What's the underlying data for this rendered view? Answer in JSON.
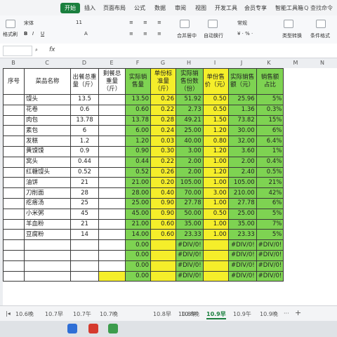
{
  "ribbon": {
    "tabs": [
      "开始",
      "插入",
      "页面布局",
      "公式",
      "数据",
      "审阅",
      "视图",
      "开发工具",
      "会员专享",
      "智能工具箱"
    ],
    "active_index": 0,
    "search": "Q 查找命令"
  },
  "toolbar": {
    "paste_format": "格式刷",
    "font_name": "宋体",
    "font_size": "11",
    "merge_center": "合并居中",
    "wrap": "自动换行",
    "number_format": "常规",
    "type_convert": "类型转换",
    "conditional_format": "条件格式"
  },
  "formula_bar": {
    "fx": "fx",
    "value": ""
  },
  "columns": [
    "B",
    "C",
    "D",
    "E",
    "F",
    "G",
    "H",
    "I",
    "J",
    "K",
    "M",
    "N"
  ],
  "headers": {
    "seq": "序号",
    "dish": "菜品名称",
    "d": "出餐总重量（斤）",
    "e": "剩餐总重量（斤）",
    "f": "实际销售量",
    "g": "单份标准量（斤）",
    "h": "实际销售份数（份）",
    "i": "单份售价（元）",
    "j": "实际销售额（元）",
    "k": "销售额占比"
  },
  "rows": [
    {
      "dish": "馒头",
      "d": "13.5",
      "f": "13.50",
      "g": "0.26",
      "h": "51.92",
      "i": "0.50",
      "j": "25.96",
      "k": "5%"
    },
    {
      "dish": "花卷",
      "d": "0.6",
      "f": "0.60",
      "g": "0.22",
      "h": "2.73",
      "i": "0.50",
      "j": "1.36",
      "k": "0.3%"
    },
    {
      "dish": "肉包",
      "d": "13.78",
      "f": "13.78",
      "g": "0.28",
      "h": "49.21",
      "i": "1.50",
      "j": "73.82",
      "k": "15%"
    },
    {
      "dish": "素包",
      "d": "6",
      "f": "6.00",
      "g": "0.24",
      "h": "25.00",
      "i": "1.20",
      "j": "30.00",
      "k": "6%"
    },
    {
      "dish": "发糕",
      "d": "1.2",
      "f": "1.20",
      "g": "0.03",
      "h": "40.00",
      "i": "0.80",
      "j": "32.00",
      "k": "6.4%"
    },
    {
      "dish": "黄馍馍",
      "d": "0.9",
      "f": "0.90",
      "g": "0.30",
      "h": "3.00",
      "i": "1.20",
      "j": "3.60",
      "k": "1%"
    },
    {
      "dish": "窝头",
      "d": "0.44",
      "f": "0.44",
      "g": "0.22",
      "h": "2.00",
      "i": "1.00",
      "j": "2.00",
      "k": "0.4%"
    },
    {
      "dish": "红糖馒头",
      "d": "0.52",
      "f": "0.52",
      "g": "0.26",
      "h": "2.00",
      "i": "1.20",
      "j": "2.40",
      "k": "0.5%"
    },
    {
      "dish": "油饼",
      "d": "21",
      "f": "21.00",
      "g": "0.20",
      "h": "105.00",
      "i": "1.00",
      "j": "105.00",
      "k": "21%"
    },
    {
      "dish": "刀削面",
      "d": "28",
      "f": "28.00",
      "g": "0.40",
      "h": "70.00",
      "i": "3.00",
      "j": "210.00",
      "k": "42%"
    },
    {
      "dish": "疙瘩汤",
      "d": "25",
      "f": "25.00",
      "g": "0.90",
      "h": "27.78",
      "i": "1.00",
      "j": "27.78",
      "k": "6%"
    },
    {
      "dish": "小米粥",
      "d": "45",
      "f": "45.00",
      "g": "0.90",
      "h": "50.00",
      "i": "0.50",
      "j": "25.00",
      "k": "5%"
    },
    {
      "dish": "羊血粉",
      "d": "21",
      "f": "21.00",
      "g": "0.60",
      "h": "35.00",
      "i": "1.00",
      "j": "35.00",
      "k": "7%"
    },
    {
      "dish": "豆腐粉",
      "d": "14",
      "f": "14.00",
      "g": "0.60",
      "h": "23.33",
      "i": "1.00",
      "j": "23.33",
      "k": "5%"
    },
    {
      "dish": "",
      "d": "",
      "f": "0.00",
      "g": "",
      "h": "#DIV/0!",
      "i": "",
      "j": "#DIV/0!",
      "k": "#DIV/0!"
    },
    {
      "dish": "",
      "d": "",
      "f": "0.00",
      "g": "",
      "h": "#DIV/0!",
      "i": "",
      "j": "#DIV/0!",
      "k": "#DIV/0!"
    },
    {
      "dish": "",
      "d": "",
      "f": "0.00",
      "g": "",
      "h": "#DIV/0!",
      "i": "",
      "j": "#DIV/0!",
      "k": "#DIV/0!"
    },
    {
      "dish": "",
      "d": "",
      "f": "0.00",
      "g": "",
      "h": "#DIV/0!",
      "i": "",
      "j": "#DIV/0!",
      "k": "#DIV/0!"
    }
  ],
  "sheet_tabs": [
    "10.6晚",
    "10.7早",
    "10.7午",
    "10.7晚",
    "10.8早",
    "10.8午",
    "10.8晚",
    "10.9早",
    "10.9午",
    "10.9晚"
  ],
  "active_sheet": "10.9早",
  "colors": {
    "green": "#7ed352",
    "yellow": "#f5ee2a",
    "accent": "#1a7f3e"
  }
}
